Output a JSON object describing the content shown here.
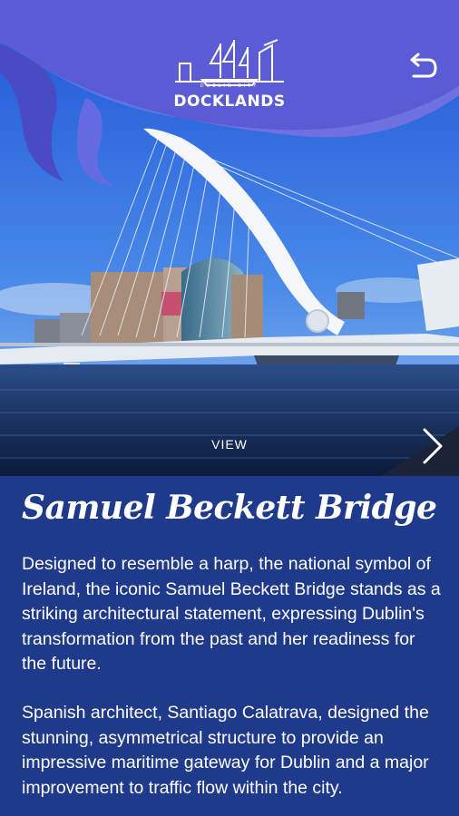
{
  "header": {
    "logo_small_text": "DUBLIN CITY",
    "logo_text": "DOCKLANDS",
    "back_icon": "back-arrow-icon"
  },
  "hero": {
    "view_label": "VIEW",
    "next_icon": "chevron-right-icon"
  },
  "content": {
    "title": "Samuel Beckett Bridge",
    "paragraphs": [
      "Designed to resemble a harp, the national symbol of Ireland, the iconic Samuel Beckett Bridge stands as a striking architectural statement, expressing Dublin's transformation from the past and her readiness for the future.",
      "Spanish architect, Santiago Calatrava, designed the stunning, asymmetrical structure to provide an impressive maritime gateway for Dublin and a major improvement to traffic flow within the city."
    ]
  },
  "colors": {
    "header_purple": "#5b5bd6",
    "panel_blue": "#1f3a8a",
    "sky_blue": "#2f6fe0"
  }
}
